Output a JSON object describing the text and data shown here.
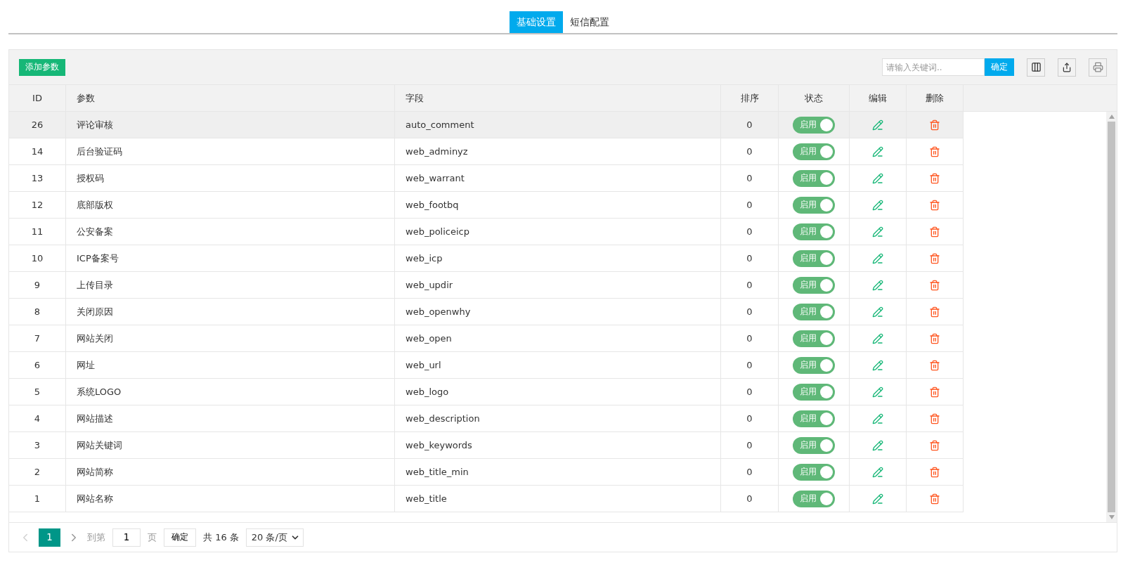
{
  "tabs": [
    {
      "label": "基础设置",
      "selected": true
    },
    {
      "label": "短信配置",
      "selected": false
    }
  ],
  "toolbar": {
    "add_button": "添加参数",
    "search": {
      "placeholder": "请输入关键词.."
    },
    "search_button": "确定"
  },
  "table": {
    "columns": [
      "ID",
      "参数",
      "字段",
      "排序",
      "状态",
      "编辑",
      "删除"
    ],
    "rows": [
      {
        "id": "26",
        "name": "评论审核",
        "field": "auto_comment",
        "order": "0",
        "status": "启用",
        "on": true,
        "selected": true
      },
      {
        "id": "14",
        "name": "后台验证码",
        "field": "web_adminyz",
        "order": "0",
        "status": "启用",
        "on": true,
        "selected": false
      },
      {
        "id": "13",
        "name": "授权码",
        "field": "web_warrant",
        "order": "0",
        "status": "启用",
        "on": true,
        "selected": false
      },
      {
        "id": "12",
        "name": "底部版权",
        "field": "web_footbq",
        "order": "0",
        "status": "启用",
        "on": true,
        "selected": false
      },
      {
        "id": "11",
        "name": "公安备案",
        "field": "web_policeicp",
        "order": "0",
        "status": "启用",
        "on": true,
        "selected": false
      },
      {
        "id": "10",
        "name": "ICP备案号",
        "field": "web_icp",
        "order": "0",
        "status": "启用",
        "on": true,
        "selected": false
      },
      {
        "id": "9",
        "name": "上传目录",
        "field": "web_updir",
        "order": "0",
        "status": "启用",
        "on": true,
        "selected": false
      },
      {
        "id": "8",
        "name": "关闭原因",
        "field": "web_openwhy",
        "order": "0",
        "status": "启用",
        "on": true,
        "selected": false
      },
      {
        "id": "7",
        "name": "网站关闭",
        "field": "web_open",
        "order": "0",
        "status": "启用",
        "on": true,
        "selected": false
      },
      {
        "id": "6",
        "name": "网址",
        "field": "web_url",
        "order": "0",
        "status": "启用",
        "on": true,
        "selected": false
      },
      {
        "id": "5",
        "name": "系统LOGO",
        "field": "web_logo",
        "order": "0",
        "status": "启用",
        "on": true,
        "selected": false
      },
      {
        "id": "4",
        "name": "网站描述",
        "field": "web_description",
        "order": "0",
        "status": "启用",
        "on": true,
        "selected": false
      },
      {
        "id": "3",
        "name": "网站关键词",
        "field": "web_keywords",
        "order": "0",
        "status": "启用",
        "on": true,
        "selected": false
      },
      {
        "id": "2",
        "name": "网站简称",
        "field": "web_title_min",
        "order": "0",
        "status": "启用",
        "on": true,
        "selected": false
      },
      {
        "id": "1",
        "name": "网站名称",
        "field": "web_title",
        "order": "0",
        "status": "启用",
        "on": true,
        "selected": false
      }
    ]
  },
  "pagination": {
    "prev_disabled": true,
    "pages": [
      {
        "label": "1",
        "selected": true
      }
    ],
    "goto_label": "到第",
    "goto_value": "1",
    "page_unit": "页",
    "confirm": "确定",
    "total": "共 16 条",
    "page_size": "20 条/页"
  }
}
